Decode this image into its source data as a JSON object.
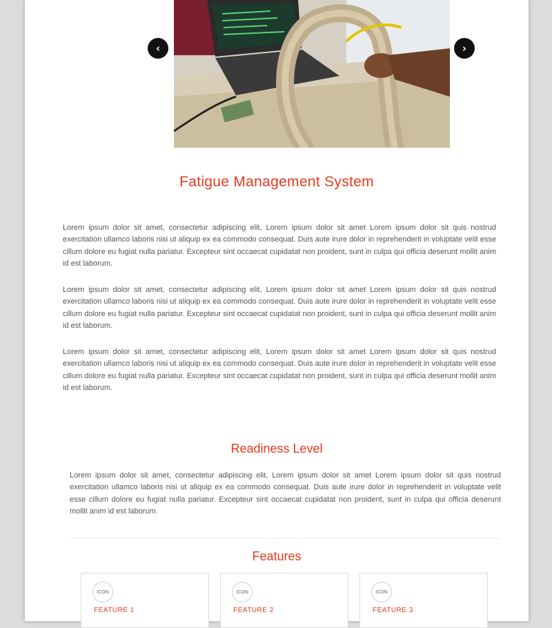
{
  "carousel": {
    "prev_label": "‹",
    "next_label": "›",
    "slide_alt": "Fatigue Management System"
  },
  "main": {
    "title": "Fatigue Management System",
    "paragraphs": [
      "Lorem ipsum dolor sit amet, consectetur adipiscing elit, Lorem ipsum dolor sit amet Lorem ipsum dolor sit quis nostrud exercitation ullamco laboris nisi ut aliquip ex ea commodo consequat. Duis aute irure dolor in reprehenderit in voluptate velit esse cillum dolore eu fugiat nulla pariatur. Excepteur sint occaecat cupidatat non proident, sunt in culpa qui officia deserunt mollit anim id est laborum.",
      "Lorem ipsum dolor sit amet, consectetur adipiscing elit, Lorem ipsum dolor sit amet Lorem ipsum dolor sit quis nostrud exercitation ullamco laboris nisi ut aliquip ex ea commodo consequat. Duis aute irure dolor in reprehenderit in voluptate velit esse cillum dolore eu fugiat nulla pariatur. Excepteur sint occaecat cupidatat non proident, sunt in culpa qui officia deserunt mollit anim id est laborum.",
      "Lorem ipsum dolor sit amet, consectetur adipiscing elit, Lorem ipsum dolor sit amet Lorem ipsum dolor sit quis nostrud exercitation ullamco laboris nisi ut aliquip ex ea commodo consequat. Duis aute irure dolor in reprehenderit in voluptate velit esse cillum dolore eu fugiat nulla pariatur. Excepteur sint occaecat cupidatat non proident, sunt in culpa qui officia deserunt mollit anim id est laborum."
    ]
  },
  "readiness": {
    "title": "Readiness Level",
    "paragraph": "Lorem ipsum dolor sit amet, consectetur adipiscing elit, Lorem ipsum dolor sit amet Lorem ipsum dolor sit quis nostrud exercitation ullamco laboris nisi ut aliquip ex ea commodo consequat. Duis aute irure dolor in reprehenderit in voluptate velit esse cillum dolore eu fugiat nulla pariatur. Excepteur sint occaecat cupidatat non proident, sunt in culpa qui officia deserunt mollit anim id est laborum."
  },
  "features": {
    "title": "Features",
    "cards": [
      {
        "icon_text": "ICON",
        "label": "FEATURE 1"
      },
      {
        "icon_text": "ICON",
        "label": "FEATURE 2"
      },
      {
        "icon_text": "ICON",
        "label": "FEATURE 3"
      }
    ]
  },
  "colors": {
    "accent": "#e63a1e",
    "page_bg": "#dcdcdc",
    "content_bg": "#ffffff",
    "body_text": "#555555"
  }
}
